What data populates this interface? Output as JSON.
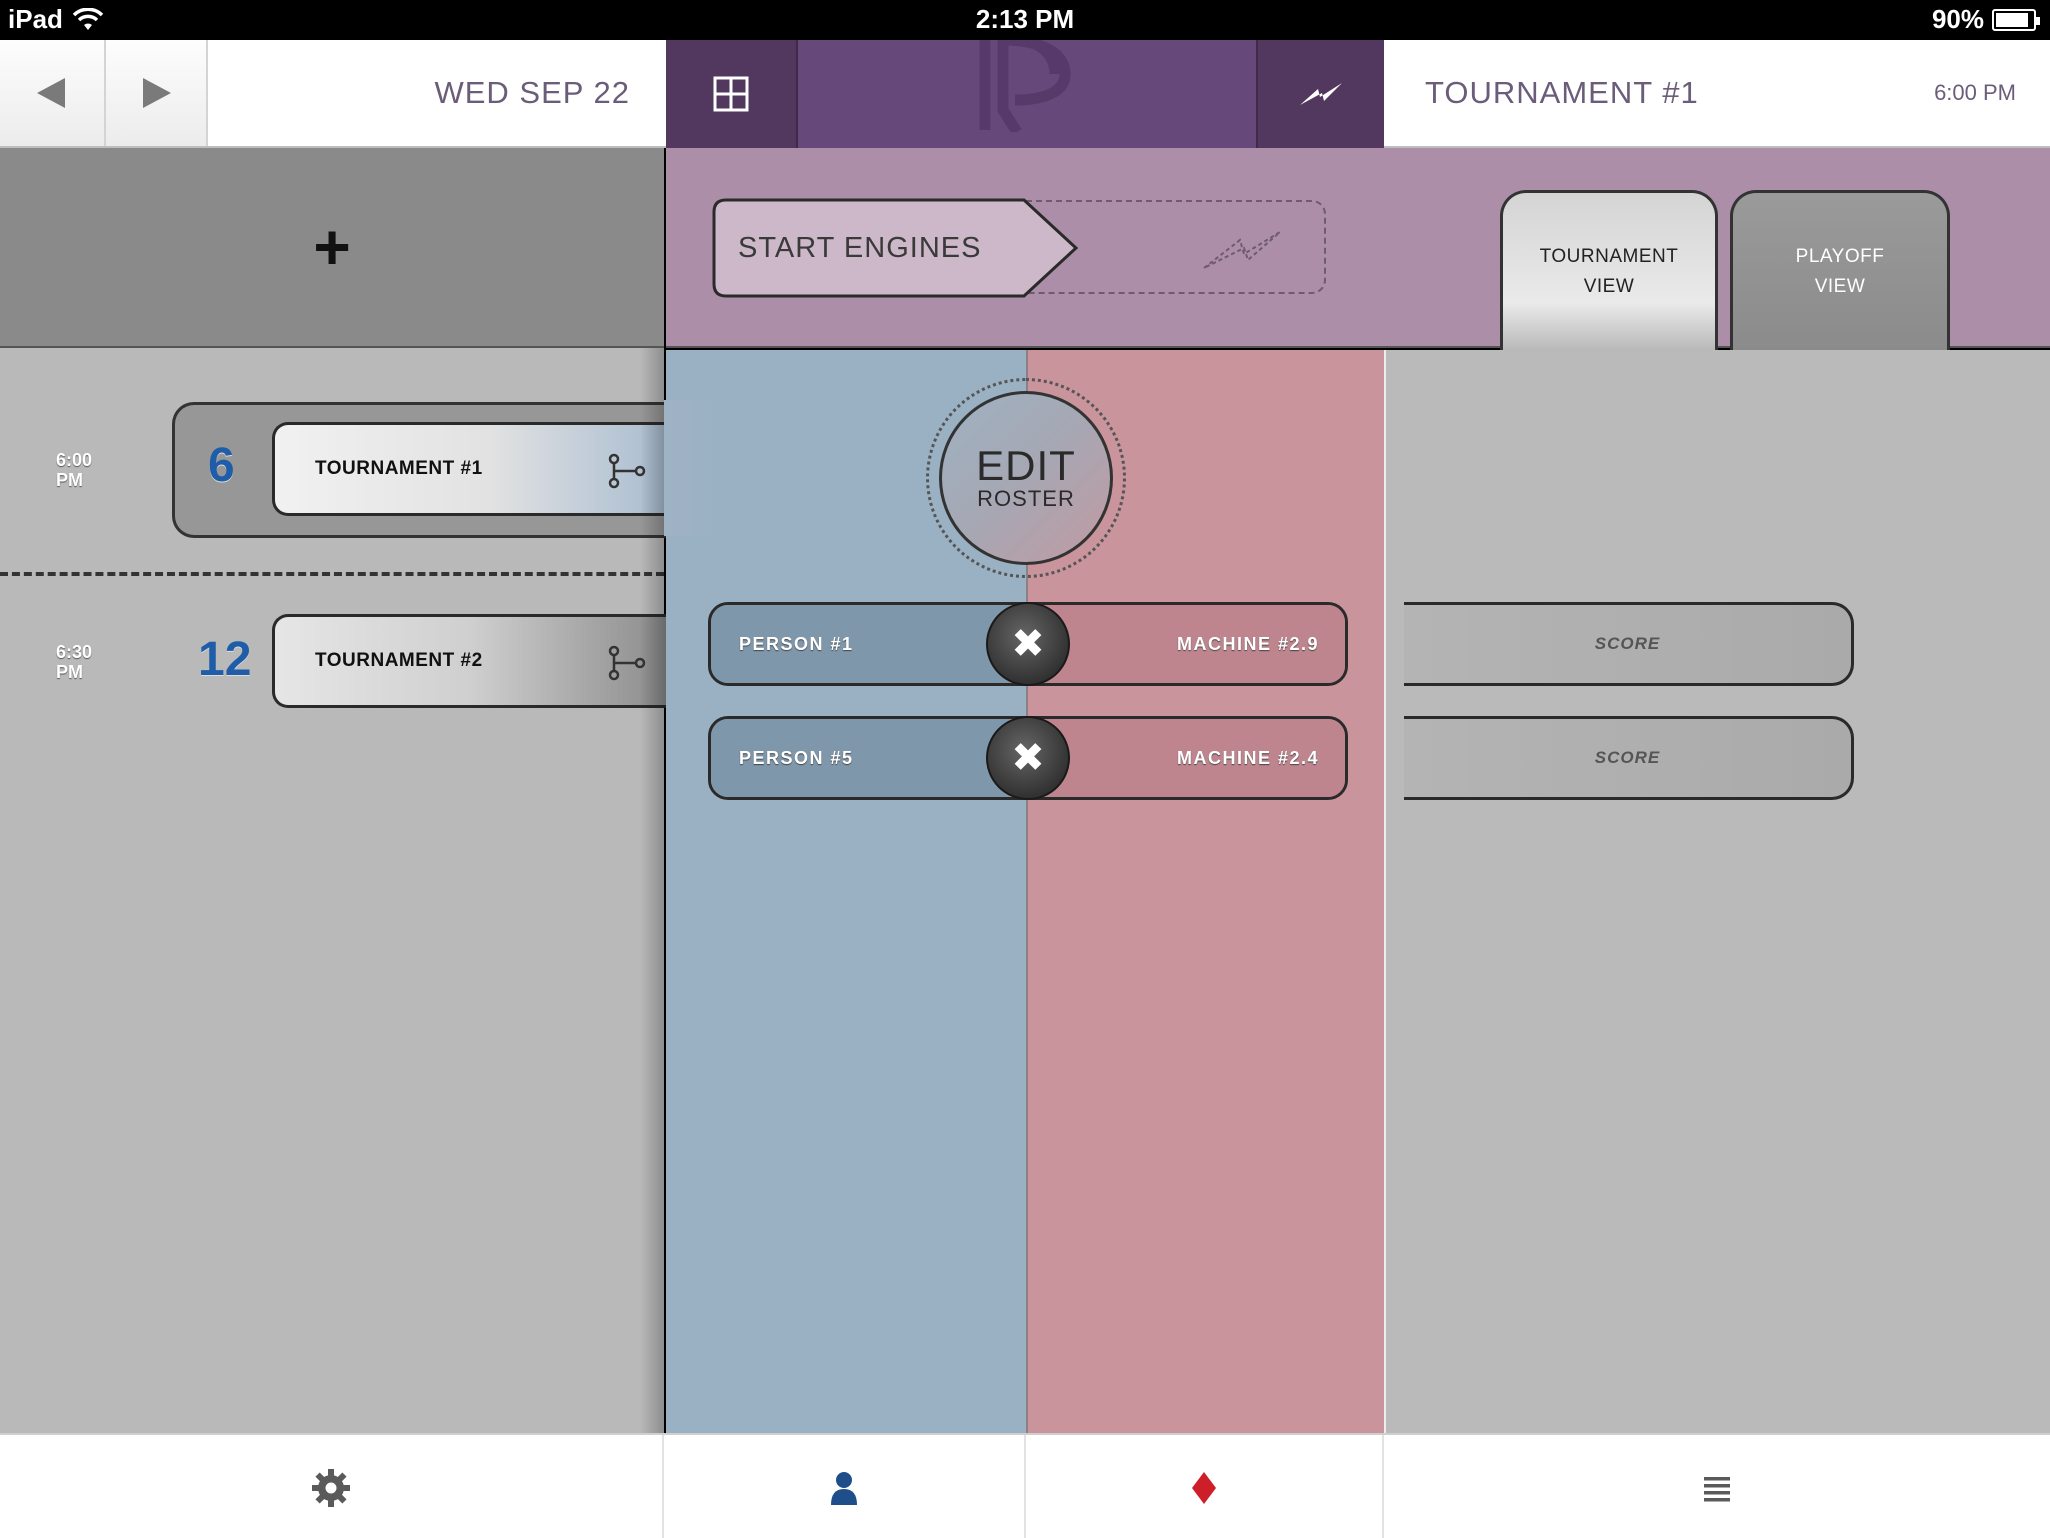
{
  "status_bar": {
    "device": "iPad",
    "time": "2:13 PM",
    "battery": "90%",
    "battery_level": 0.9
  },
  "header": {
    "prev_icon": "triangle-left-icon",
    "next_icon": "triangle-right-icon",
    "date": "WED SEP 22",
    "grid_icon": "grid-icon",
    "action_icon": "lightning-icon",
    "tournament_title": "TOURNAMENT #1",
    "tournament_time": "6:00 PM",
    "colors": {
      "purple": "#66497a",
      "purple_dark": "#52375f"
    }
  },
  "schedule": {
    "add_label": "+",
    "slots": [
      {
        "time_line1": "6:00",
        "time_line2": "PM",
        "count": "6",
        "name": "TOURNAMENT #1",
        "active": true
      },
      {
        "time_line1": "6:30",
        "time_line2": "PM",
        "count": "12",
        "name": "TOURNAMENT #2",
        "active": false
      }
    ]
  },
  "controls": {
    "start_label": "START ENGINES",
    "tabs": [
      {
        "line1": "TOURNAMENT",
        "line2": "VIEW",
        "active": true
      },
      {
        "line1": "PLAYOFF",
        "line2": "VIEW",
        "active": false
      }
    ]
  },
  "roster": {
    "edit_line1": "EDIT",
    "edit_line2": "ROSTER",
    "matches": [
      {
        "player": "PERSON #1",
        "machine": "MACHINE #2.9",
        "score_label": "SCORE"
      },
      {
        "player": "PERSON #5",
        "machine": "MACHINE #2.4",
        "score_label": "SCORE"
      }
    ],
    "remove_glyph": "✖",
    "colors": {
      "blue": "#9ab0c3",
      "red": "#c9949c"
    }
  },
  "tabbar": {
    "items": [
      {
        "icon": "gear-icon"
      },
      {
        "icon": "person-icon"
      },
      {
        "icon": "diamond-icon"
      },
      {
        "icon": "list-icon"
      }
    ]
  }
}
